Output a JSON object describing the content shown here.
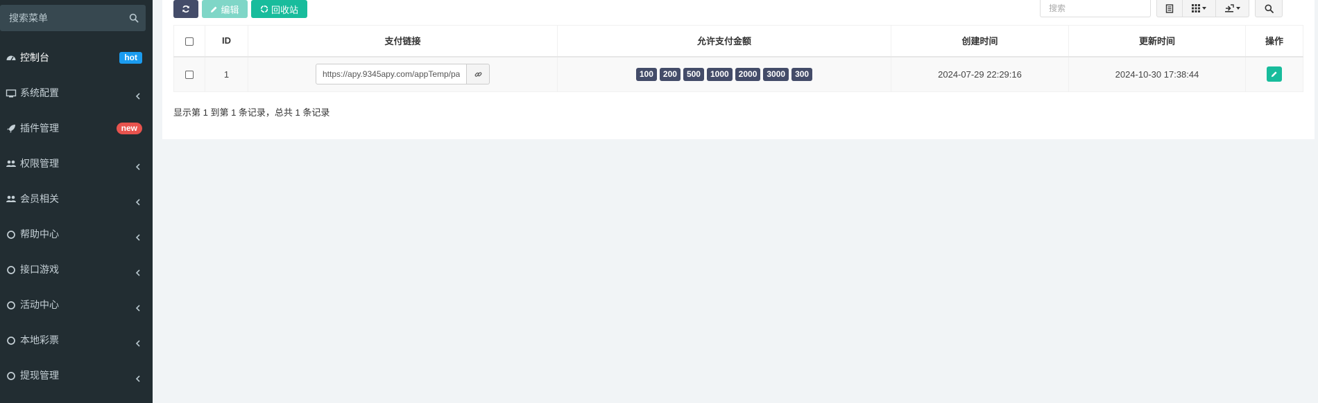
{
  "sidebar": {
    "search_placeholder": "搜索菜单",
    "items": [
      {
        "label": "控制台",
        "badge": "hot"
      },
      {
        "label": "系统配置"
      },
      {
        "label": "插件管理",
        "badge": "new"
      },
      {
        "label": "权限管理"
      },
      {
        "label": "会员相关"
      },
      {
        "label": "帮助中心"
      },
      {
        "label": "接口游戏"
      },
      {
        "label": "活动中心"
      },
      {
        "label": "本地彩票"
      },
      {
        "label": "提现管理"
      }
    ]
  },
  "toolbar": {
    "edit_label": "编辑",
    "recycle_label": "回收站",
    "search_placeholder": "搜索"
  },
  "table": {
    "headers": {
      "id": "ID",
      "pay_link": "支付链接",
      "amounts": "允许支付金额",
      "created": "创建时间",
      "updated": "更新时间",
      "actions": "操作"
    },
    "rows": [
      {
        "id": "1",
        "pay_link": "https://apy.9345apy.com/appTemp/pa",
        "amounts": [
          "100",
          "200",
          "500",
          "1000",
          "2000",
          "3000",
          "300"
        ],
        "created": "2024-07-29 22:29:16",
        "updated": "2024-10-30 17:38:44"
      }
    ]
  },
  "pagination": {
    "info": "显示第 1 到第 1 条记录，总共 1 条记录"
  },
  "colors": {
    "sidebar_bg": "#222d32",
    "primary": "#444c69",
    "success": "#18bc9c",
    "badge_hot": "#1b9cf0",
    "badge_new": "#e8534e"
  }
}
